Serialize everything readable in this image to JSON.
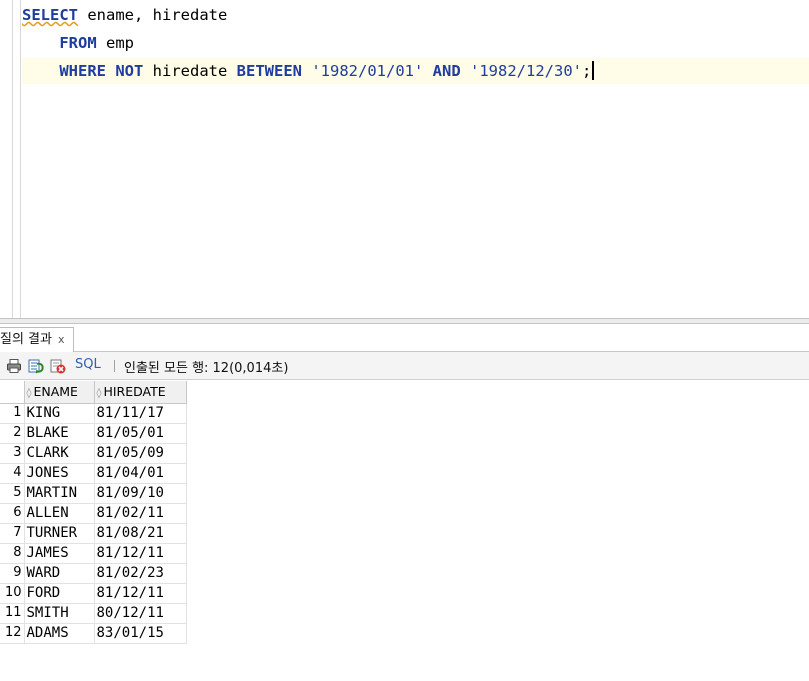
{
  "editor": {
    "lines": [
      {
        "tokens": [
          {
            "t": "SELECT",
            "cls": "kw squiggle"
          },
          {
            "t": " ename, hiredate",
            "cls": ""
          }
        ]
      },
      {
        "tokens": [
          {
            "t": "    ",
            "cls": ""
          },
          {
            "t": "FROM",
            "cls": "kw"
          },
          {
            "t": " emp",
            "cls": ""
          }
        ]
      },
      {
        "tokens": [
          {
            "t": "    ",
            "cls": ""
          },
          {
            "t": "WHERE",
            "cls": "kw"
          },
          {
            "t": " ",
            "cls": ""
          },
          {
            "t": "NOT",
            "cls": "kw"
          },
          {
            "t": " hiredate ",
            "cls": ""
          },
          {
            "t": "BETWEEN",
            "cls": "kw"
          },
          {
            "t": " ",
            "cls": ""
          },
          {
            "t": "'1982/01/01'",
            "cls": "str"
          },
          {
            "t": " ",
            "cls": ""
          },
          {
            "t": "AND",
            "cls": "kw"
          },
          {
            "t": " ",
            "cls": ""
          },
          {
            "t": "'1982/12/30'",
            "cls": "str"
          },
          {
            "t": ";",
            "cls": ""
          }
        ],
        "current": true
      }
    ]
  },
  "result_tab": {
    "label": "질의 결과",
    "close_glyph": "x"
  },
  "toolbar": {
    "print_icon": "printer-icon",
    "refresh_icon": "refresh-icon",
    "cancel_icon": "cancel-icon",
    "sql_label": "SQL",
    "separator": "|",
    "status_text": "인출된 모든 행: 12(0,014초)"
  },
  "grid": {
    "columns": [
      "ENAME",
      "HIREDATE"
    ],
    "rows": [
      [
        "1",
        "KING",
        "81/11/17"
      ],
      [
        "2",
        "BLAKE",
        "81/05/01"
      ],
      [
        "3",
        "CLARK",
        "81/05/09"
      ],
      [
        "4",
        "JONES",
        "81/04/01"
      ],
      [
        "5",
        "MARTIN",
        "81/09/10"
      ],
      [
        "6",
        "ALLEN",
        "81/02/11"
      ],
      [
        "7",
        "TURNER",
        "81/08/21"
      ],
      [
        "8",
        "JAMES",
        "81/12/11"
      ],
      [
        "9",
        "WARD",
        "81/02/23"
      ],
      [
        "10",
        "FORD",
        "81/12/11"
      ],
      [
        "11",
        "SMITH",
        "80/12/11"
      ],
      [
        "12",
        "ADAMS",
        "83/01/15"
      ]
    ]
  },
  "colors": {
    "keyword": "#1f3c9e",
    "current_line": "#fffde8",
    "sql_link": "#3060b0"
  }
}
